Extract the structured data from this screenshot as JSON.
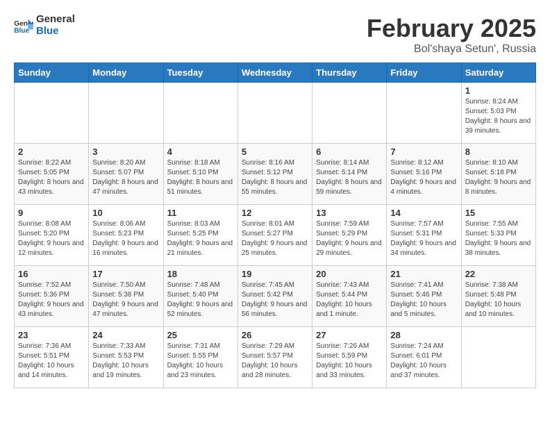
{
  "logo": {
    "general": "General",
    "blue": "Blue"
  },
  "title": "February 2025",
  "subtitle": "Bol'shaya Setun', Russia",
  "days_of_week": [
    "Sunday",
    "Monday",
    "Tuesday",
    "Wednesday",
    "Thursday",
    "Friday",
    "Saturday"
  ],
  "weeks": [
    [
      {
        "day": "",
        "info": ""
      },
      {
        "day": "",
        "info": ""
      },
      {
        "day": "",
        "info": ""
      },
      {
        "day": "",
        "info": ""
      },
      {
        "day": "",
        "info": ""
      },
      {
        "day": "",
        "info": ""
      },
      {
        "day": "1",
        "info": "Sunrise: 8:24 AM\nSunset: 5:03 PM\nDaylight: 8 hours and 39 minutes."
      }
    ],
    [
      {
        "day": "2",
        "info": "Sunrise: 8:22 AM\nSunset: 5:05 PM\nDaylight: 8 hours and 43 minutes."
      },
      {
        "day": "3",
        "info": "Sunrise: 8:20 AM\nSunset: 5:07 PM\nDaylight: 8 hours and 47 minutes."
      },
      {
        "day": "4",
        "info": "Sunrise: 8:18 AM\nSunset: 5:10 PM\nDaylight: 8 hours and 51 minutes."
      },
      {
        "day": "5",
        "info": "Sunrise: 8:16 AM\nSunset: 5:12 PM\nDaylight: 8 hours and 55 minutes."
      },
      {
        "day": "6",
        "info": "Sunrise: 8:14 AM\nSunset: 5:14 PM\nDaylight: 8 hours and 59 minutes."
      },
      {
        "day": "7",
        "info": "Sunrise: 8:12 AM\nSunset: 5:16 PM\nDaylight: 9 hours and 4 minutes."
      },
      {
        "day": "8",
        "info": "Sunrise: 8:10 AM\nSunset: 5:18 PM\nDaylight: 9 hours and 8 minutes."
      }
    ],
    [
      {
        "day": "9",
        "info": "Sunrise: 8:08 AM\nSunset: 5:20 PM\nDaylight: 9 hours and 12 minutes."
      },
      {
        "day": "10",
        "info": "Sunrise: 8:06 AM\nSunset: 5:23 PM\nDaylight: 9 hours and 16 minutes."
      },
      {
        "day": "11",
        "info": "Sunrise: 8:03 AM\nSunset: 5:25 PM\nDaylight: 9 hours and 21 minutes."
      },
      {
        "day": "12",
        "info": "Sunrise: 8:01 AM\nSunset: 5:27 PM\nDaylight: 9 hours and 25 minutes."
      },
      {
        "day": "13",
        "info": "Sunrise: 7:59 AM\nSunset: 5:29 PM\nDaylight: 9 hours and 29 minutes."
      },
      {
        "day": "14",
        "info": "Sunrise: 7:57 AM\nSunset: 5:31 PM\nDaylight: 9 hours and 34 minutes."
      },
      {
        "day": "15",
        "info": "Sunrise: 7:55 AM\nSunset: 5:33 PM\nDaylight: 9 hours and 38 minutes."
      }
    ],
    [
      {
        "day": "16",
        "info": "Sunrise: 7:52 AM\nSunset: 5:36 PM\nDaylight: 9 hours and 43 minutes."
      },
      {
        "day": "17",
        "info": "Sunrise: 7:50 AM\nSunset: 5:38 PM\nDaylight: 9 hours and 47 minutes."
      },
      {
        "day": "18",
        "info": "Sunrise: 7:48 AM\nSunset: 5:40 PM\nDaylight: 9 hours and 52 minutes."
      },
      {
        "day": "19",
        "info": "Sunrise: 7:45 AM\nSunset: 5:42 PM\nDaylight: 9 hours and 56 minutes."
      },
      {
        "day": "20",
        "info": "Sunrise: 7:43 AM\nSunset: 5:44 PM\nDaylight: 10 hours and 1 minute."
      },
      {
        "day": "21",
        "info": "Sunrise: 7:41 AM\nSunset: 5:46 PM\nDaylight: 10 hours and 5 minutes."
      },
      {
        "day": "22",
        "info": "Sunrise: 7:38 AM\nSunset: 5:48 PM\nDaylight: 10 hours and 10 minutes."
      }
    ],
    [
      {
        "day": "23",
        "info": "Sunrise: 7:36 AM\nSunset: 5:51 PM\nDaylight: 10 hours and 14 minutes."
      },
      {
        "day": "24",
        "info": "Sunrise: 7:33 AM\nSunset: 5:53 PM\nDaylight: 10 hours and 19 minutes."
      },
      {
        "day": "25",
        "info": "Sunrise: 7:31 AM\nSunset: 5:55 PM\nDaylight: 10 hours and 23 minutes."
      },
      {
        "day": "26",
        "info": "Sunrise: 7:29 AM\nSunset: 5:57 PM\nDaylight: 10 hours and 28 minutes."
      },
      {
        "day": "27",
        "info": "Sunrise: 7:26 AM\nSunset: 5:59 PM\nDaylight: 10 hours and 33 minutes."
      },
      {
        "day": "28",
        "info": "Sunrise: 7:24 AM\nSunset: 6:01 PM\nDaylight: 10 hours and 37 minutes."
      },
      {
        "day": "",
        "info": ""
      }
    ]
  ]
}
